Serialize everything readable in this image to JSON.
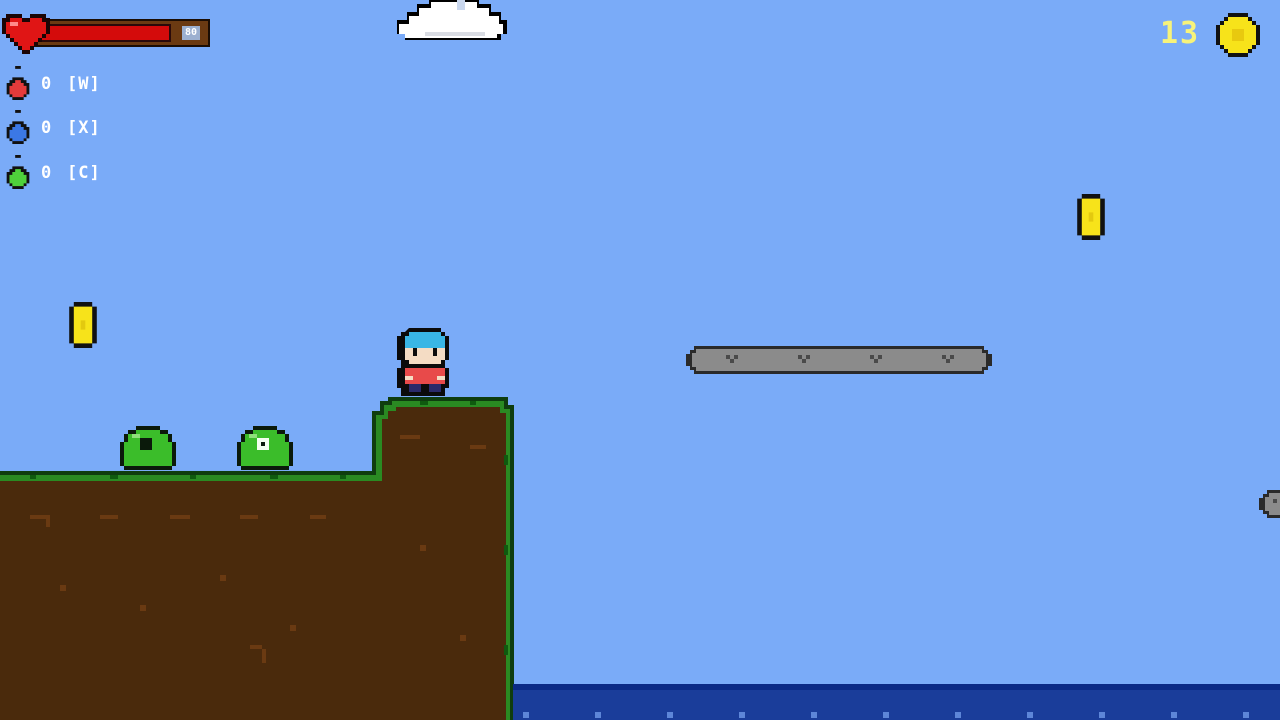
{
  "hud": {
    "health": {
      "value": "80",
      "fraction": 0.8,
      "icon": "heart-icon",
      "color": "#d40b0b"
    },
    "potions": [
      {
        "name": "red-potion",
        "count": "0",
        "key": "[W]",
        "color": "#e53b3b"
      },
      {
        "name": "blue-potion",
        "count": "0",
        "key": "[X]",
        "color": "#3b78e5"
      },
      {
        "name": "green-potion",
        "count": "0",
        "key": "[C]",
        "color": "#4fd13b"
      }
    ],
    "coins": {
      "count": "13",
      "icon": "coin-icon",
      "color": "#f7e31a"
    }
  },
  "colors": {
    "sky": "#7aabf8",
    "dirt": "#4a2a0c",
    "grass": "#1f7a1f",
    "water": "#1a3d9a",
    "slime": "#3bbd2a",
    "player_hair": "#39b6e5",
    "player_shirt": "#e84a4a"
  }
}
